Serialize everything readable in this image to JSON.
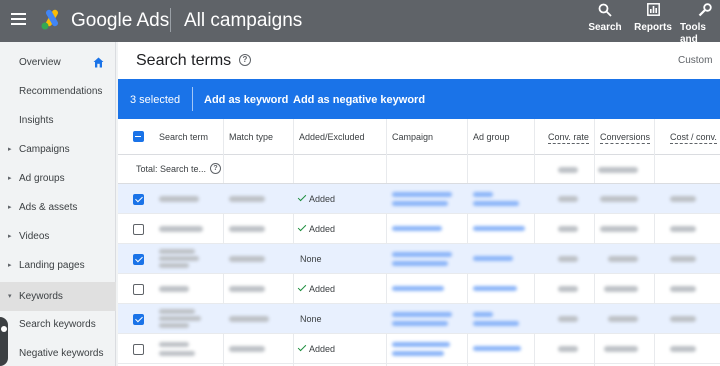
{
  "topbar": {
    "brand": "Google Ads",
    "page_name": "All campaigns",
    "tools": [
      {
        "label": "Search",
        "icon": "search-icon"
      },
      {
        "label": "Reports",
        "icon": "reports-icon"
      },
      {
        "label": "Tools and settings",
        "icon": "wrench-icon"
      }
    ]
  },
  "sidebar": {
    "items": [
      {
        "label": "Overview"
      },
      {
        "label": "Recommendations"
      },
      {
        "label": "Insights"
      },
      {
        "label": "Campaigns"
      },
      {
        "label": "Ad groups"
      },
      {
        "label": "Ads & assets"
      },
      {
        "label": "Videos"
      },
      {
        "label": "Landing pages"
      },
      {
        "label": "Keywords"
      },
      {
        "label": "Search keywords"
      },
      {
        "label": "Negative keywords"
      }
    ]
  },
  "main": {
    "title": "Search terms",
    "custom": "Custom",
    "selection": {
      "count": "3 selected",
      "add_keyword": "Add as keyword",
      "add_negative": "Add as negative keyword"
    },
    "columns": {
      "search_term": "Search term",
      "match_type": "Match type",
      "added_excluded": "Added/Excluded",
      "campaign": "Campaign",
      "ad_group": "Ad group",
      "conv_rate": "Conv. rate",
      "conversions": "Conversions",
      "cost_conv": "Cost / conv."
    },
    "total_label": "Total: Search te...",
    "rows": [
      {
        "selected": true,
        "status": "Added"
      },
      {
        "selected": false,
        "status": "Added"
      },
      {
        "selected": true,
        "status": "None"
      },
      {
        "selected": false,
        "status": "Added"
      },
      {
        "selected": true,
        "status": "None"
      },
      {
        "selected": false,
        "status": "Added"
      }
    ]
  },
  "colors": {
    "topbar": "#5f6368",
    "accent": "#1a73e8",
    "selected_row": "#e8f0fe",
    "added_check": "#1e8e3e"
  }
}
